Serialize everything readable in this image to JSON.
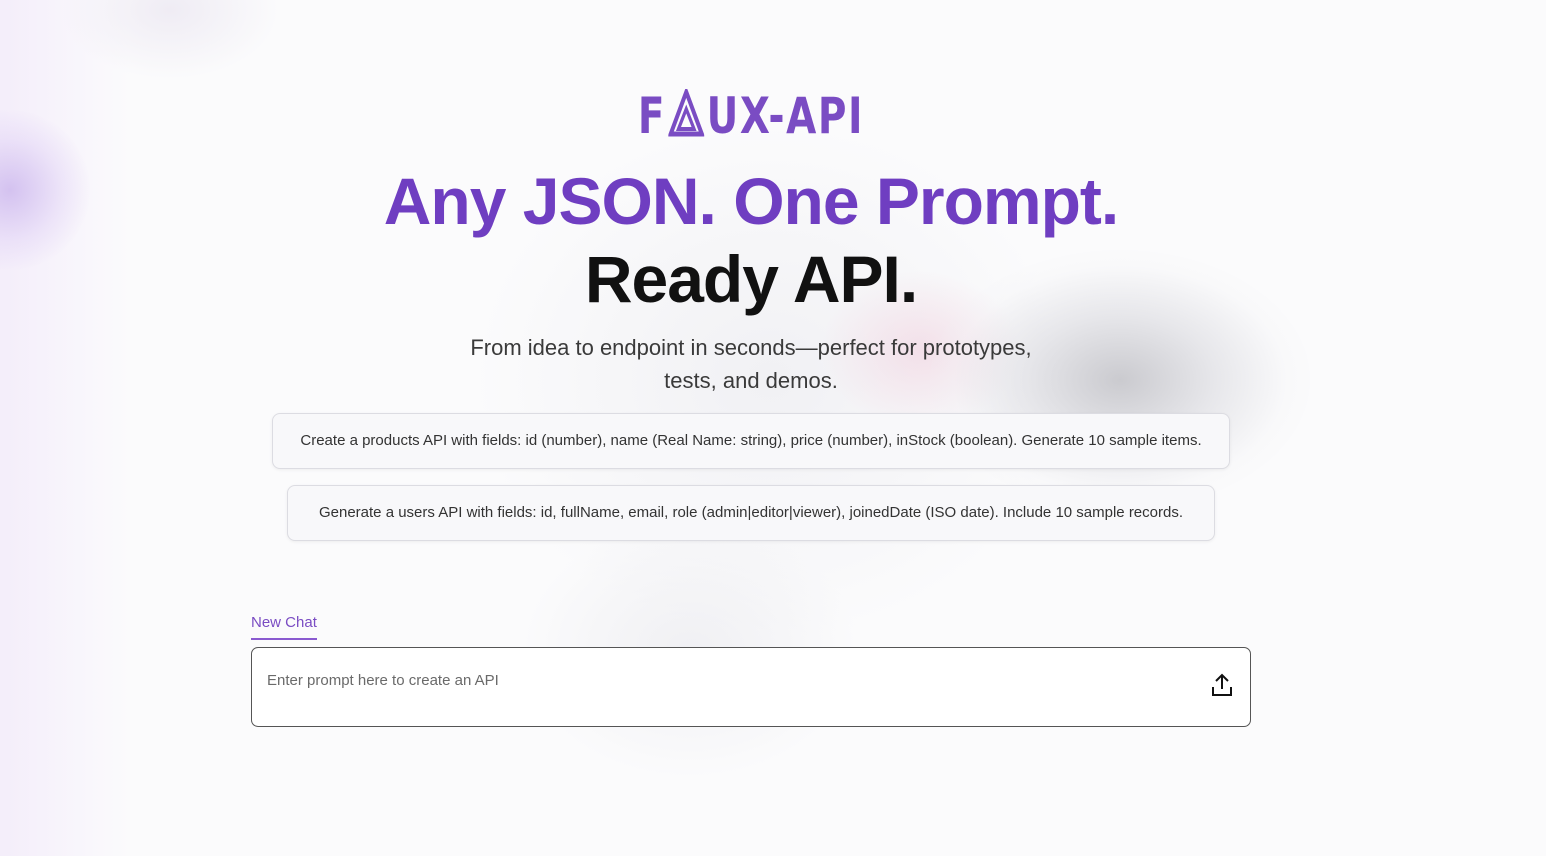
{
  "logo": {
    "prefix": "F",
    "suffix": "UX-API",
    "mark_icon": "triangle-a-icon",
    "brand_color": "#7a4cc3"
  },
  "hero": {
    "headline_line1": "Any JSON. One Prompt.",
    "headline_line2": "Ready API.",
    "subtitle": "From idea to endpoint in seconds—perfect for prototypes, tests, and demos."
  },
  "suggestions": [
    "Create a products API with fields: id (number), name (Real Name: string), price (number), inStock (boolean). Generate 10 sample items.",
    "Generate a users API with fields: id, fullName, email, role (admin|editor|viewer), joinedDate (ISO date). Include 10 sample records."
  ],
  "chat": {
    "tab_label": "New Chat",
    "input_value": "",
    "placeholder": "Enter prompt here to create an API",
    "submit_icon": "upload-icon"
  }
}
